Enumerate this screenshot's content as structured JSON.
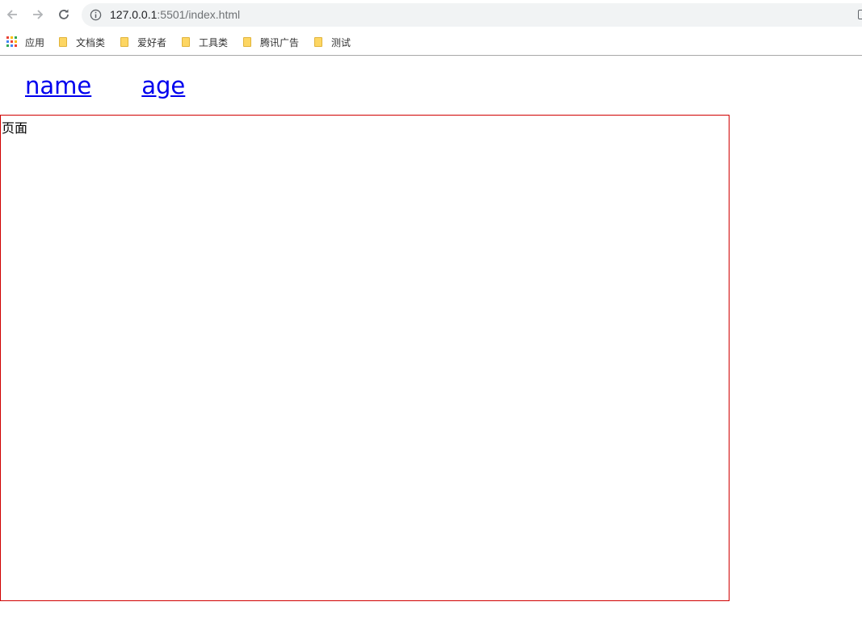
{
  "browser": {
    "url_host": "127.0.0.1",
    "url_rest": ":5501/index.html",
    "bookmarks": [
      {
        "label": "应用",
        "icon": "apps-grid-icon"
      },
      {
        "label": "文档类",
        "icon": "folder-icon"
      },
      {
        "label": "爱好者",
        "icon": "folder-icon"
      },
      {
        "label": "工具类",
        "icon": "folder-icon"
      },
      {
        "label": "腾讯广告",
        "icon": "folder-icon"
      },
      {
        "label": "测试",
        "icon": "folder-icon"
      }
    ]
  },
  "page": {
    "links": [
      {
        "label": "name"
      },
      {
        "label": "age"
      }
    ],
    "view_text": "页面"
  },
  "colors": {
    "link": "#0000ee",
    "view_border": "#d00000",
    "omnibox_bg": "#f1f3f4",
    "folder": "#fdd663"
  }
}
